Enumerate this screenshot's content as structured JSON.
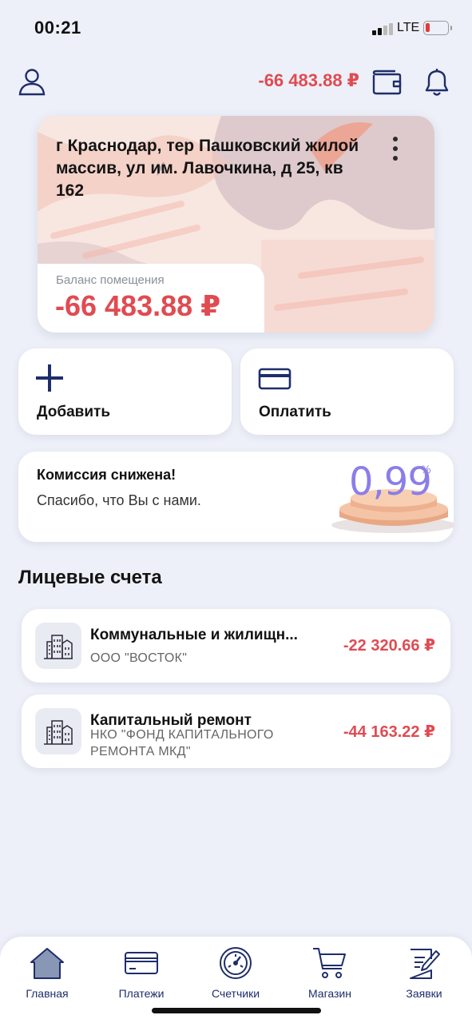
{
  "status_bar": {
    "time": "00:21",
    "network": "LTE",
    "battery_level": 0.15
  },
  "header": {
    "balance": "-66 483.88 ₽",
    "icons": [
      "user-icon",
      "wallet-icon",
      "bell-icon"
    ]
  },
  "property": {
    "address": "г Краснодар, тер Пашковский жилой массив, ул им. Лавочкина, д 25, кв 162",
    "balance_label": "Баланс помещения",
    "balance": "-66 483.88 ₽"
  },
  "actions": {
    "add_label": "Добавить",
    "pay_label": "Оплатить"
  },
  "promo": {
    "title": "Комиссия снижена!",
    "subtitle": "Спасибо, что Вы с нами.",
    "rate": "0,99",
    "rate_unit": "%"
  },
  "accounts": {
    "title": "Лицевые счета",
    "items": [
      {
        "title": "Коммунальные и жилищн...",
        "subtitle": "ООО \"ВОСТОК\"",
        "amount": "-22 320.66 ₽"
      },
      {
        "title": "Капитальный ремонт",
        "subtitle": "НКО \"ФОНД КАПИТАЛЬНОГО РЕМОНТА МКД\"",
        "amount": "-44 163.22 ₽"
      }
    ]
  },
  "nav": {
    "items": [
      {
        "label": "Главная",
        "icon": "home-icon",
        "active": true
      },
      {
        "label": "Платежи",
        "icon": "card-icon",
        "active": false
      },
      {
        "label": "Счетчики",
        "icon": "meter-icon",
        "active": false
      },
      {
        "label": "Магазин",
        "icon": "cart-icon",
        "active": false
      },
      {
        "label": "Заявки",
        "icon": "request-icon",
        "active": false
      }
    ]
  },
  "colors": {
    "accent": "#1f2d6b",
    "negative": "#e04b52",
    "promo": "#8b7ee8",
    "background": "#edf0f8"
  }
}
